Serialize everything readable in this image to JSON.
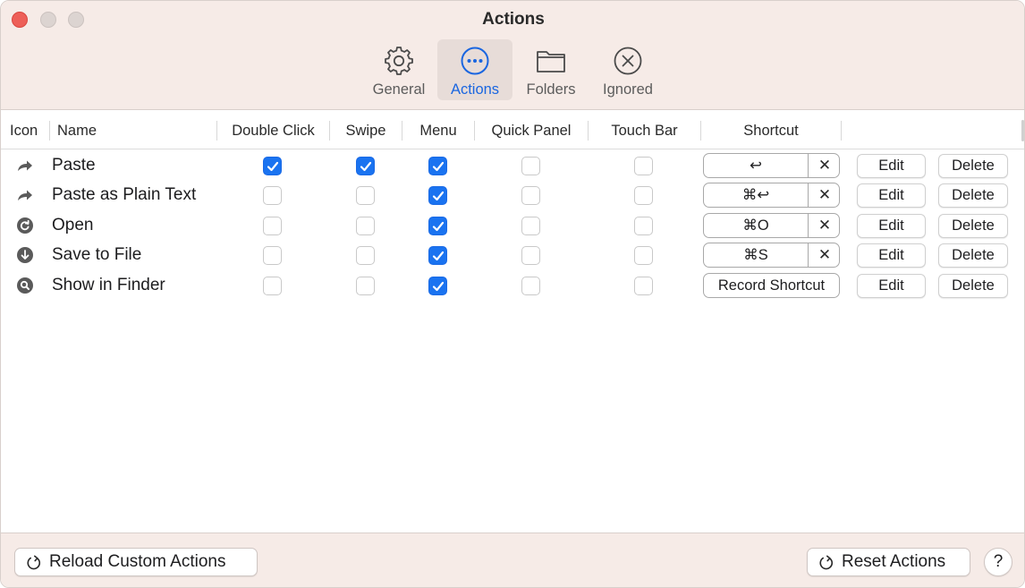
{
  "window": {
    "title": "Actions"
  },
  "toolbar": {
    "tabs": [
      {
        "label": "General",
        "icon": "gear-icon",
        "active": false
      },
      {
        "label": "Actions",
        "icon": "ellipsis-circle-icon",
        "active": true
      },
      {
        "label": "Folders",
        "icon": "folder-icon",
        "active": false
      },
      {
        "label": "Ignored",
        "icon": "x-circle-icon",
        "active": false
      }
    ]
  },
  "table": {
    "columns": [
      "Icon",
      "Name",
      "Double Click",
      "Swipe",
      "Menu",
      "Quick Panel",
      "Touch Bar",
      "Shortcut"
    ],
    "rows": [
      {
        "icon": "arrow-forward-icon",
        "name": "Paste",
        "double_click": true,
        "swipe": true,
        "menu": true,
        "quick_panel": false,
        "touch_bar": false,
        "shortcut": "↩",
        "has_shortcut": true
      },
      {
        "icon": "arrow-forward-icon",
        "name": "Paste as Plain Text",
        "double_click": false,
        "swipe": false,
        "menu": true,
        "quick_panel": false,
        "touch_bar": false,
        "shortcut": "⌘↩",
        "has_shortcut": true
      },
      {
        "icon": "open-circle-icon",
        "name": "Open",
        "double_click": false,
        "swipe": false,
        "menu": true,
        "quick_panel": false,
        "touch_bar": false,
        "shortcut": "⌘O",
        "has_shortcut": true
      },
      {
        "icon": "download-circle-icon",
        "name": "Save to File",
        "double_click": false,
        "swipe": false,
        "menu": true,
        "quick_panel": false,
        "touch_bar": false,
        "shortcut": "⌘S",
        "has_shortcut": true
      },
      {
        "icon": "search-circle-icon",
        "name": "Show in Finder",
        "double_click": false,
        "swipe": false,
        "menu": true,
        "quick_panel": false,
        "touch_bar": false,
        "shortcut": "Record Shortcut",
        "has_shortcut": false
      }
    ],
    "clear_symbol": "✕",
    "edit_label": "Edit",
    "delete_label": "Delete"
  },
  "footer": {
    "reload_label": "Reload Custom Actions",
    "reset_label": "Reset Actions",
    "help_label": "?"
  },
  "colors": {
    "accent": "#1a73f0",
    "chrome": "#f6ebe7",
    "close_button": "#ed5f58"
  }
}
